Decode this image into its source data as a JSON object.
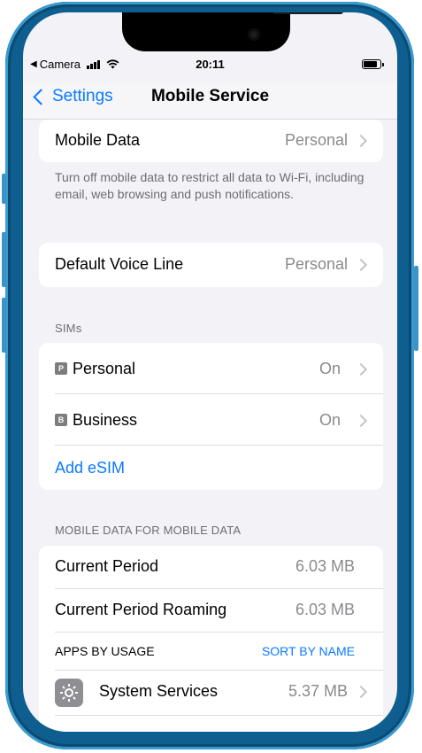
{
  "status_bar": {
    "back_app": "Camera",
    "time": "20:11"
  },
  "nav": {
    "back_label": "Settings",
    "title": "Mobile Service"
  },
  "mobile_data": {
    "label": "Mobile Data",
    "value": "Personal",
    "footer": "Turn off mobile data to restrict all data to Wi-Fi, including email, web browsing and push notifications."
  },
  "default_voice": {
    "label": "Default Voice Line",
    "value": "Personal"
  },
  "sims": {
    "header": "SIMs",
    "items": [
      {
        "badge": "P",
        "label": "Personal",
        "value": "On"
      },
      {
        "badge": "B",
        "label": "Business",
        "value": "On"
      }
    ],
    "add_label": "Add eSIM"
  },
  "usage": {
    "header": "MOBILE DATA FOR MOBILE DATA",
    "current_period": {
      "label": "Current Period",
      "value": "6.03 MB"
    },
    "current_roaming": {
      "label": "Current Period Roaming",
      "value": "6.03 MB"
    },
    "apps_header": "APPS BY USAGE",
    "sort_label": "SORT BY NAME",
    "apps": [
      {
        "label": "System Services",
        "value": "5.37 MB",
        "icon": "gear-icon"
      }
    ]
  },
  "colors": {
    "accent": "#0a7aff",
    "background": "#f2f2f7",
    "frame": "#0e5f8f"
  }
}
